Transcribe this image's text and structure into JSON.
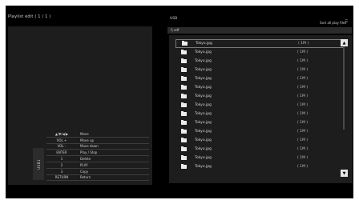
{
  "header": {
    "title": "Playlist edit ( 1 / 1 )",
    "path": "USB",
    "sort": "Sort all play files"
  },
  "path_bar": "\\\\ xdf",
  "side_tab": "USB1",
  "key_guide": [
    {
      "key": "▲/▼/◀/▶",
      "action": "Move"
    },
    {
      "key": "VOL +",
      "action": "Move up"
    },
    {
      "key": "VOL -",
      "action": "Move down"
    },
    {
      "key": "ENTER",
      "action": "Play / Stop"
    },
    {
      "key": "1",
      "action": "Delete"
    },
    {
      "key": "2",
      "action": "PLAY"
    },
    {
      "key": "3",
      "action": "Copy"
    },
    {
      "key": "RETURN",
      "action": "Return"
    }
  ],
  "files": [
    {
      "name": "Tokyo.jpg",
      "size": "( 1M )",
      "selected": true
    },
    {
      "name": "Tokyo.jpg",
      "size": "( 1M )"
    },
    {
      "name": "Tokyo.jpg",
      "size": "( 1M )"
    },
    {
      "name": "Tokyo.jpg",
      "size": "( 1M )"
    },
    {
      "name": "Tokyo.jpg",
      "size": "( 1M )"
    },
    {
      "name": "Tokyo.jpg",
      "size": "( 1M )"
    },
    {
      "name": "Tokyo.jpg",
      "size": "( 1M )"
    },
    {
      "name": "Tokyo.jpg",
      "size": "( 1M )"
    },
    {
      "name": "Tokyo.jpg",
      "size": "( 1M )"
    },
    {
      "name": "Tokyo.jpg",
      "size": "( 1M )"
    },
    {
      "name": "Tokyo.jpg",
      "size": "( 1M )"
    },
    {
      "name": "Tokyo.jpg",
      "size": "( 1M )"
    },
    {
      "name": "Tokyo.jpg",
      "size": "( 1M )"
    },
    {
      "name": "Tokyo.jpg",
      "size": "( 1M )"
    },
    {
      "name": "Tokyo.jpg",
      "size": "( 1M )"
    }
  ],
  "icons": {
    "sort": "list-icon",
    "scroll_up": "arrow-up-icon",
    "scroll_down": "arrow-down-icon",
    "file": "image-file-icon"
  },
  "colors": {
    "background": "#000000",
    "panel": "#1d1d1d",
    "text": "#d6d6d6",
    "selection_border": "#7a7a7a"
  }
}
